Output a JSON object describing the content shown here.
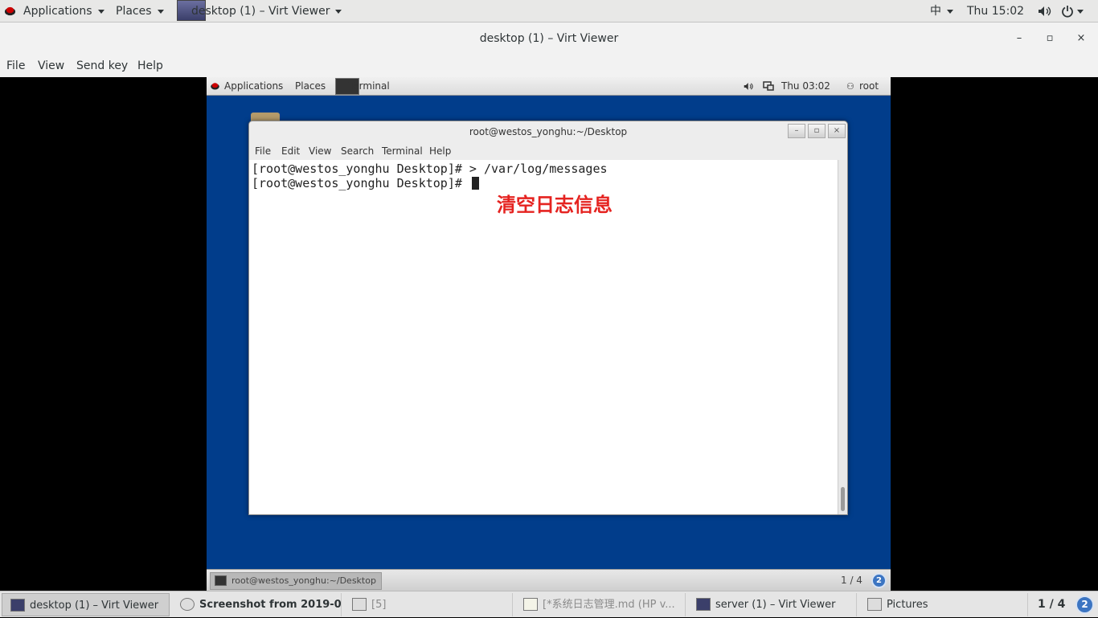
{
  "host_topbar": {
    "applications": "Applications",
    "places": "Places",
    "window_menu": "desktop (1) – Virt Viewer",
    "input_method": "中",
    "clock": "Thu 15:02"
  },
  "window": {
    "title": "desktop (1) – Virt Viewer",
    "minimize": "–",
    "maximize": "▫",
    "close": "×"
  },
  "menubar": {
    "file": "File",
    "view": "View",
    "send_key": "Send key",
    "help": "Help"
  },
  "guest_panel": {
    "applications": "Applications",
    "places": "Places",
    "terminal": "Terminal",
    "clock": "Thu 03:02",
    "user": "root"
  },
  "terminal": {
    "title": "root@westos_yonghu:~/Desktop",
    "menu": [
      "File",
      "Edit",
      "View",
      "Search",
      "Terminal",
      "Help"
    ],
    "lines": [
      "[root@westos_yonghu Desktop]# > /var/log/messages",
      "[root@westos_yonghu Desktop]# "
    ]
  },
  "annotation": "清空日志信息",
  "guest_taskbar": {
    "item": "root@westos_yonghu:~/Desktop",
    "workspace": "1 / 4",
    "badge": "2"
  },
  "host_taskbar": {
    "items": [
      "desktop (1) – Virt Viewer",
      "Screenshot from 2019-0...",
      "[5]",
      "[*系统日志管理.md (HP v...",
      "server (1) – Virt Viewer",
      "Pictures"
    ],
    "workspace": "1 / 4",
    "badge": "2"
  }
}
